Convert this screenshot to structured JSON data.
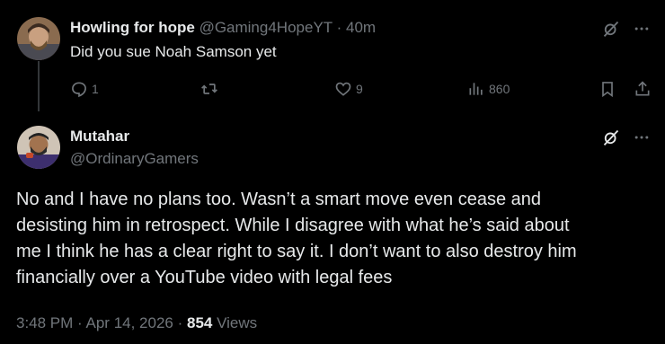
{
  "reply": {
    "name": "Howling for hope",
    "handle": "@Gaming4HopeYT",
    "separator": "·",
    "time": "40m",
    "text": "Did you sue Noah Samson yet",
    "actions": {
      "replies": "1",
      "reposts": "",
      "likes": "9",
      "views": "860"
    }
  },
  "main_tweet": {
    "name": "Mutahar",
    "handle": "@OrdinaryGamers",
    "text_lines": [
      "No and I have no plans too. Wasn’t a smart move even cease and",
      "desisting him in retrospect. While I disagree with what he’s said about",
      "me I think he has a clear right to say it. I don’t want to also destroy him",
      "financially over a YouTube video with legal fees"
    ],
    "time": "3:48 PM",
    "sep1": "·",
    "date": "Apr 14, 2026",
    "sep2": "·",
    "views_count": "854",
    "views_label": "Views"
  },
  "icons": {
    "grok": "grok-icon",
    "more": "more-icon",
    "reply": "reply-icon",
    "repost": "repost-icon",
    "like": "like-icon",
    "views": "views-icon",
    "bookmark": "bookmark-icon",
    "share": "share-icon"
  },
  "colors": {
    "background": "#000000",
    "text": "#e7e9ea",
    "muted": "#71767b",
    "thread_line": "#333639"
  }
}
